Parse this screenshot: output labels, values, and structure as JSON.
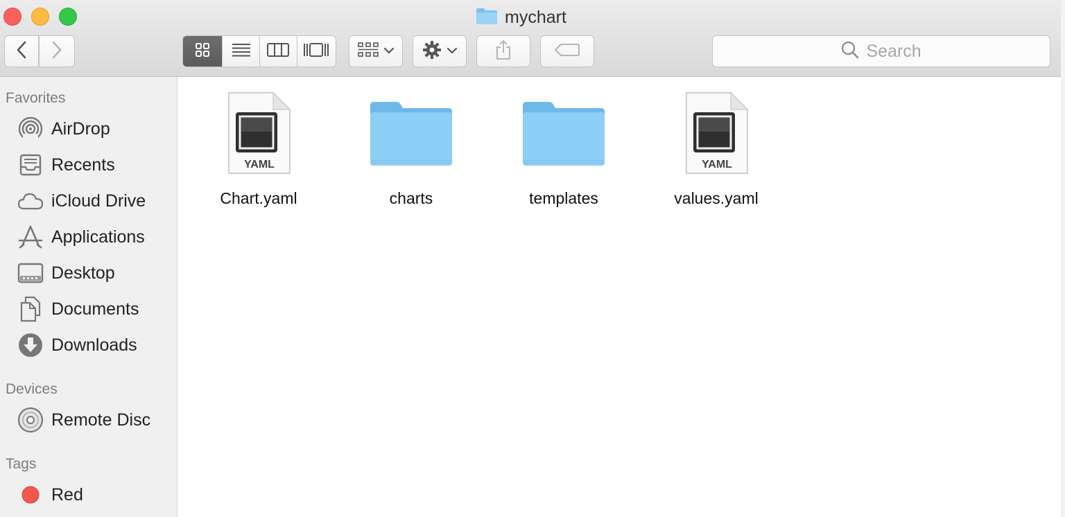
{
  "window": {
    "title": "mychart"
  },
  "toolbar": {
    "back_label": "Back",
    "forward_label": "Forward",
    "search_placeholder": "Search"
  },
  "sidebar": {
    "favorites_header": "Favorites",
    "favorites": [
      {
        "label": "AirDrop",
        "icon": "airdrop-icon"
      },
      {
        "label": "Recents",
        "icon": "recents-icon"
      },
      {
        "label": "iCloud Drive",
        "icon": "icloud-icon"
      },
      {
        "label": "Applications",
        "icon": "applications-icon"
      },
      {
        "label": "Desktop",
        "icon": "desktop-icon"
      },
      {
        "label": "Documents",
        "icon": "documents-icon"
      },
      {
        "label": "Downloads",
        "icon": "downloads-icon"
      }
    ],
    "devices_header": "Devices",
    "devices": [
      {
        "label": "Remote Disc",
        "icon": "disc-icon"
      }
    ],
    "tags_header": "Tags",
    "tags": [
      {
        "label": "Red",
        "color": "#f0584f"
      }
    ]
  },
  "files": [
    {
      "name": "Chart.yaml",
      "kind": "yaml-file",
      "badge": "YAML"
    },
    {
      "name": "charts",
      "kind": "folder"
    },
    {
      "name": "templates",
      "kind": "folder"
    },
    {
      "name": "values.yaml",
      "kind": "yaml-file",
      "badge": "YAML"
    }
  ],
  "colors": {
    "folder": "#8ecff7",
    "folder_dark": "#6fb8ea",
    "tag_red": "#f0584f"
  }
}
